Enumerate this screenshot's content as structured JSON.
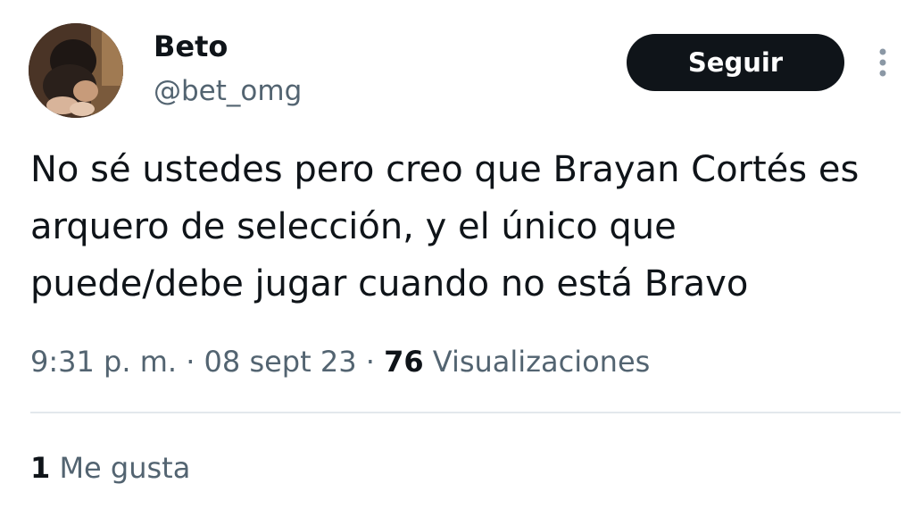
{
  "user": {
    "display_name": "Beto",
    "handle": "@bet_omg"
  },
  "follow_button": {
    "label": "Seguir"
  },
  "more_options": {
    "icon": "vertical-ellipsis-icon"
  },
  "tweet": {
    "text": "No sé ustedes pero creo que Brayan Cortés es arquero de selección, y el único que puede/debe jugar cuando no está Bravo"
  },
  "meta": {
    "time": "9:31 p. m.",
    "separator": "·",
    "date": "08 sept 23",
    "views_count": "76",
    "views_label": "Visualizaciones"
  },
  "engagement": {
    "likes_count": "1",
    "likes_label": "Me gusta"
  },
  "colors": {
    "text_primary": "#0f1419",
    "text_secondary": "#536471",
    "divider": "#e3e8ec",
    "button_bg": "#0f1419",
    "button_text": "#ffffff"
  }
}
